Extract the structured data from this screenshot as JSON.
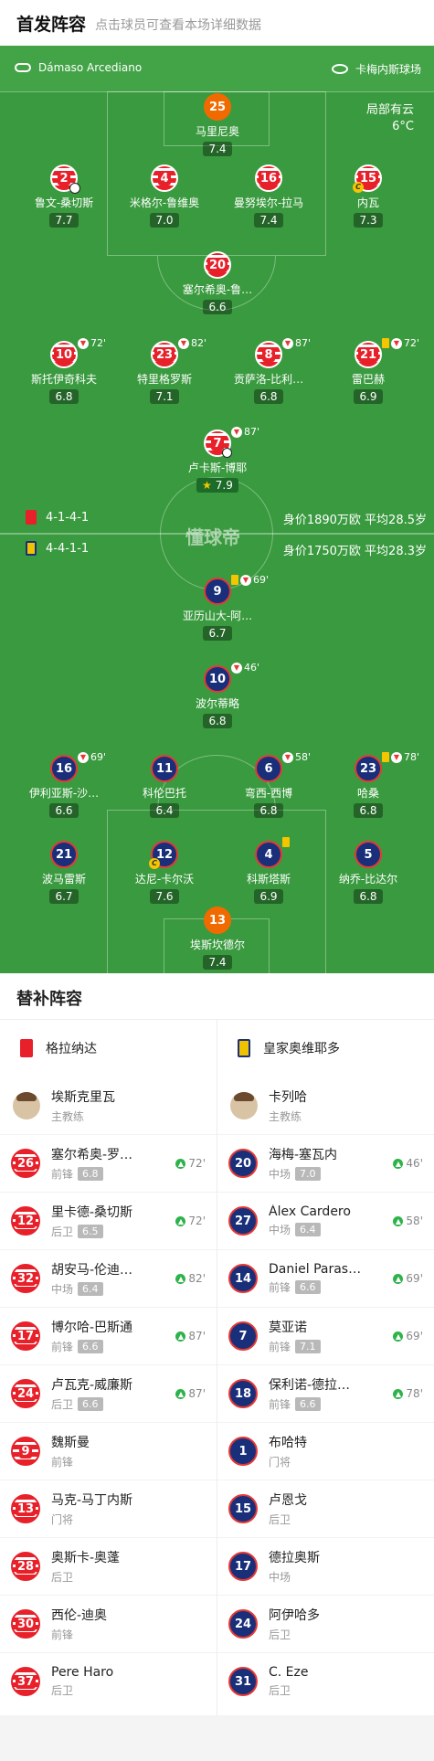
{
  "header": {
    "title": "首发阵容",
    "subtitle": "点击球员可查看本场详细数据"
  },
  "match_info": {
    "referee": "Dámaso Arcediano",
    "venue": "卡梅内斯球场",
    "weather": "局部有云",
    "temperature": "6°C",
    "brand": "懂球帝"
  },
  "home_team": {
    "formation": "4-1-4-1",
    "value": "身价1890万欧 平均28.5岁",
    "color": "#e8202a"
  },
  "away_team": {
    "formation": "4-4-1-1",
    "value": "身价1750万欧 平均28.3岁",
    "color": "#1a2f7a"
  },
  "home_lineup": [
    {
      "num": "25",
      "name": "马里尼奥",
      "rating": "7.4"
    },
    {
      "num": "2",
      "name": "鲁文-桑切斯",
      "rating": "7.7"
    },
    {
      "num": "4",
      "name": "米格尔-鲁维奥",
      "rating": "7.0"
    },
    {
      "num": "16",
      "name": "曼努埃尔-拉马",
      "rating": "7.4"
    },
    {
      "num": "15",
      "name": "内瓦",
      "rating": "7.3"
    },
    {
      "num": "20",
      "name": "塞尔希奥-鲁…",
      "rating": "6.6"
    },
    {
      "num": "10",
      "name": "斯托伊奇科夫",
      "rating": "6.8",
      "sub": "72'"
    },
    {
      "num": "23",
      "name": "特里格罗斯",
      "rating": "7.1",
      "sub": "82'"
    },
    {
      "num": "8",
      "name": "贡萨洛-比利…",
      "rating": "6.8",
      "sub": "87'"
    },
    {
      "num": "21",
      "name": "雷巴赫",
      "rating": "6.9",
      "sub": "72'"
    },
    {
      "num": "7",
      "name": "卢卡斯-博耶",
      "rating": "7.9",
      "sub": "87'"
    }
  ],
  "away_lineup": [
    {
      "num": "9",
      "name": "亚历山大-阿…",
      "rating": "6.7",
      "sub": "69'"
    },
    {
      "num": "10",
      "name": "波尔蒂略",
      "rating": "6.8",
      "sub": "46'"
    },
    {
      "num": "16",
      "name": "伊利亚斯-沙…",
      "rating": "6.6",
      "sub": "69'"
    },
    {
      "num": "11",
      "name": "科伦巴托",
      "rating": "6.4"
    },
    {
      "num": "6",
      "name": "弯西-西博",
      "rating": "6.8",
      "sub": "58'"
    },
    {
      "num": "23",
      "name": "哈桑",
      "rating": "6.8",
      "sub": "78'"
    },
    {
      "num": "21",
      "name": "波马雷斯",
      "rating": "6.7"
    },
    {
      "num": "12",
      "name": "达尼-卡尔沃",
      "rating": "7.6"
    },
    {
      "num": "4",
      "name": "科斯塔斯",
      "rating": "6.9"
    },
    {
      "num": "5",
      "name": "纳乔-比达尔",
      "rating": "6.8"
    },
    {
      "num": "13",
      "name": "埃斯坎德尔",
      "rating": "7.4"
    }
  ],
  "bench": {
    "title": "替补阵容",
    "home": {
      "team": "格拉纳达",
      "coach": {
        "name": "埃斯克里瓦",
        "role": "主教练"
      },
      "players": [
        {
          "num": "26",
          "name": "塞尔希奥-罗…",
          "pos": "前锋",
          "rating": "6.8",
          "minute": "72'"
        },
        {
          "num": "12",
          "name": "里卡德-桑切斯",
          "pos": "后卫",
          "rating": "6.5",
          "minute": "72'"
        },
        {
          "num": "32",
          "name": "胡安马-伦迪…",
          "pos": "中场",
          "rating": "6.4",
          "minute": "82'"
        },
        {
          "num": "17",
          "name": "博尔哈-巴斯通",
          "pos": "前锋",
          "rating": "6.6",
          "minute": "87'"
        },
        {
          "num": "24",
          "name": "卢瓦克-威廉斯",
          "pos": "后卫",
          "rating": "6.6",
          "minute": "87'"
        },
        {
          "num": "9",
          "name": "魏斯曼",
          "pos": "前锋"
        },
        {
          "num": "13",
          "name": "马克-马丁内斯",
          "pos": "门将"
        },
        {
          "num": "28",
          "name": "奥斯卡-奥蓬",
          "pos": "后卫"
        },
        {
          "num": "30",
          "name": "西伦-迪奥",
          "pos": "前锋"
        },
        {
          "num": "37",
          "name": "Pere Haro",
          "pos": "后卫"
        }
      ]
    },
    "away": {
      "team": "皇家奥维耶多",
      "coach": {
        "name": "卡列哈",
        "role": "主教练"
      },
      "players": [
        {
          "num": "20",
          "name": "海梅-塞瓦内",
          "pos": "中场",
          "rating": "7.0",
          "minute": "46'"
        },
        {
          "num": "27",
          "name": "Álex Cardero",
          "pos": "中场",
          "rating": "6.4",
          "minute": "58'"
        },
        {
          "num": "14",
          "name": "Daniel Paras…",
          "pos": "前锋",
          "rating": "6.6",
          "minute": "69'"
        },
        {
          "num": "7",
          "name": "莫亚诺",
          "pos": "前锋",
          "rating": "7.1",
          "minute": "69'"
        },
        {
          "num": "18",
          "name": "保利诺-德拉…",
          "pos": "前锋",
          "rating": "6.6",
          "minute": "78'"
        },
        {
          "num": "1",
          "name": "布哈特",
          "pos": "门将"
        },
        {
          "num": "15",
          "name": "卢恩戈",
          "pos": "后卫"
        },
        {
          "num": "17",
          "name": "德拉奥斯",
          "pos": "中场"
        },
        {
          "num": "24",
          "name": "阿伊哈多",
          "pos": "后卫"
        },
        {
          "num": "31",
          "name": "C. Eze",
          "pos": "后卫"
        }
      ]
    }
  }
}
